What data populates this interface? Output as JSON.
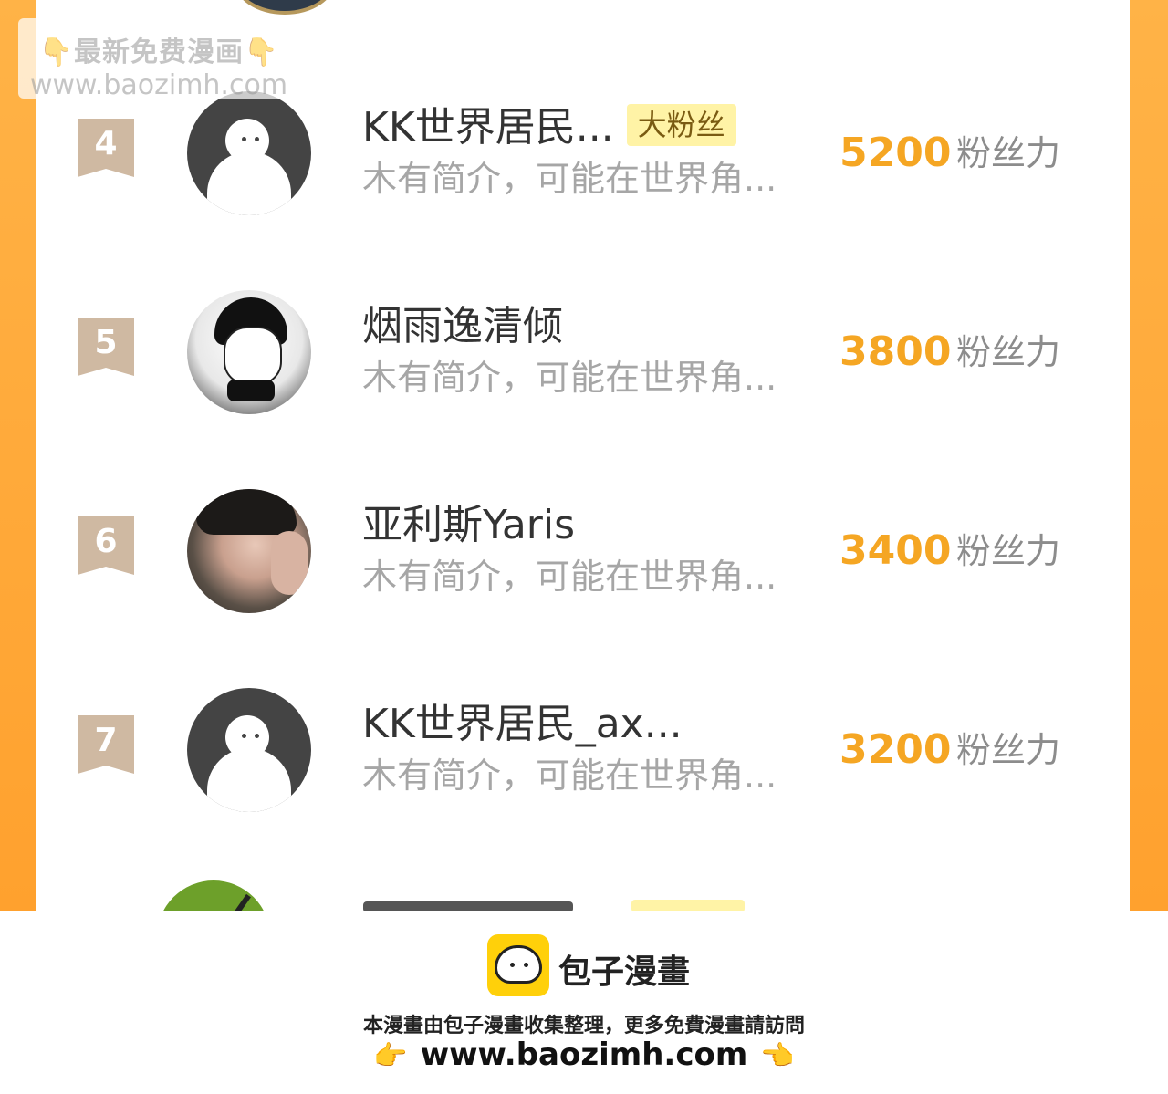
{
  "watermark": {
    "line1": "👇最新免费漫画👇",
    "line2": "www.baozimh.com"
  },
  "fans_list": [
    {
      "rank": "4",
      "name": "KK世界居民...",
      "badge": "大粉丝",
      "desc": "木有简介，可能在世界角...",
      "score": "5200",
      "score_unit": "粉丝力",
      "avatar": "default-avatar"
    },
    {
      "rank": "5",
      "name": "烟雨逸清倾",
      "badge": "",
      "desc": "木有简介，可能在世界角...",
      "score": "3800",
      "score_unit": "粉丝力",
      "avatar": "manga-avatar"
    },
    {
      "rank": "6",
      "name": "亚利斯Yaris",
      "badge": "",
      "desc": "木有简介，可能在世界角...",
      "score": "3400",
      "score_unit": "粉丝力",
      "avatar": "photo-avatar"
    },
    {
      "rank": "7",
      "name": "KK世界居民_ax...",
      "badge": "",
      "desc": "木有简介，可能在世界角...",
      "score": "3200",
      "score_unit": "粉丝力",
      "avatar": "default-avatar"
    }
  ],
  "footer": {
    "brand": "包子漫畫",
    "note": "本漫畫由包子漫畫收集整理，更多免費漫畫請訪問",
    "url": "www.baozimh.com",
    "pointer_left": "👉",
    "pointer_right": "👈"
  },
  "colors": {
    "accent": "#f5a623",
    "badge_bg": "#fff3a6",
    "rank_bg": "#cfb9a2",
    "frame": "#ffa12e"
  }
}
